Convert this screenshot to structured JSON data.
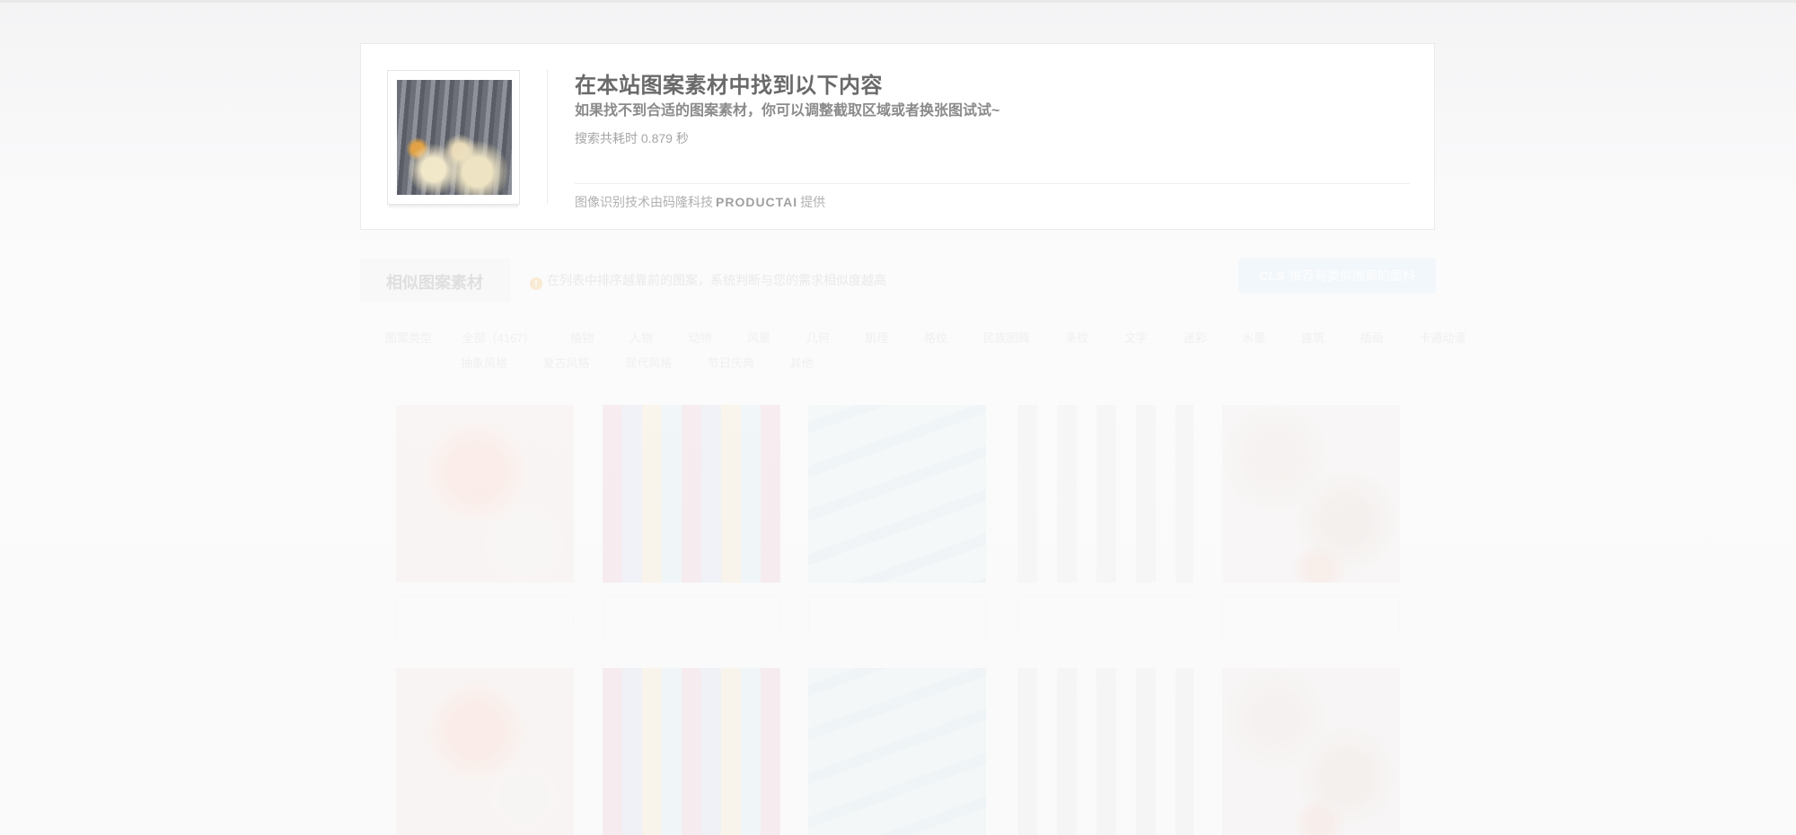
{
  "result": {
    "title": "在本站图案素材中找到以下内容",
    "subtitle": "如果找不到合适的图案素材，你可以调整截取区域或者换张图试试~",
    "search_time": "搜索共耗时 0.879 秒",
    "provider_prefix": "图像识别技术由码隆科技",
    "provider_brand": "PRODUCTAI",
    "provider_suffix": "提供",
    "query_image_icon": "query-image"
  },
  "similar": {
    "tab_label": "相似图案素材",
    "notice_text": "在列表中排序越靠前的图案，系统判断与您的需求相似度越高",
    "recommend_badge": "CLS",
    "recommend_label": "推荐有类似图案的面料",
    "filter_label": "图案类型",
    "filters_row1": [
      "全部（4167）",
      "植物",
      "人物",
      "动物",
      "风景",
      "几何",
      "肌理",
      "格纹",
      "民族图腾",
      "条纹",
      "文字",
      "迷彩",
      "水墨",
      "建筑",
      "插画",
      "卡通动漫"
    ],
    "filters_row2": [
      "抽象风格",
      "复古风格",
      "现代风格",
      "节日庆典",
      "其他"
    ]
  },
  "grid": {
    "row1": [
      {
        "pattern": "flower",
        "caption": "",
        "meta": ""
      },
      {
        "pattern": "vase",
        "caption": "",
        "meta": ""
      },
      {
        "pattern": "wave",
        "caption": "",
        "meta": ""
      },
      {
        "pattern": "stripe",
        "caption": "",
        "meta": ""
      },
      {
        "pattern": "leaf",
        "caption": "",
        "meta": ""
      }
    ],
    "row2": [
      {
        "pattern": "flower"
      },
      {
        "pattern": "vase"
      },
      {
        "pattern": "wave"
      },
      {
        "pattern": "stripe"
      },
      {
        "pattern": "leaf"
      }
    ]
  },
  "colors": {
    "title_text": "#6a6a6a",
    "recommend_button_bg": "#e6f2fb",
    "notice_icon": "#f7d6a2"
  }
}
